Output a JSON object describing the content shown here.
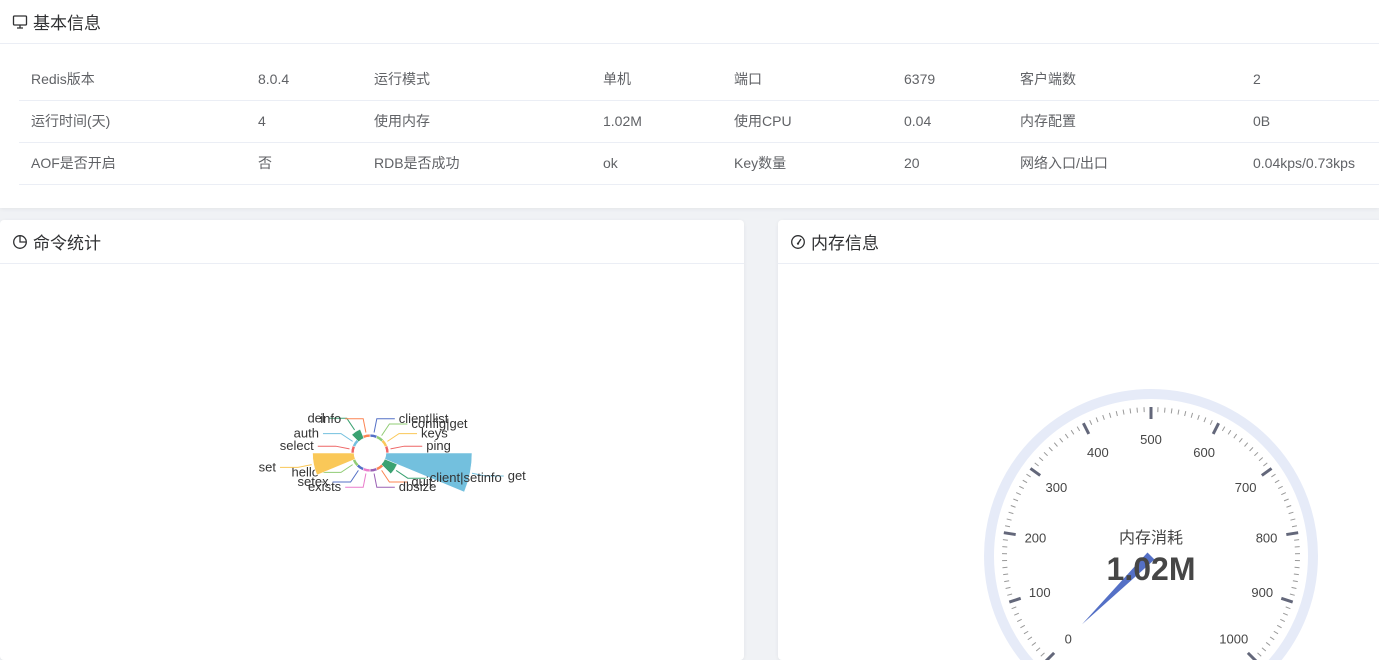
{
  "basic_info": {
    "title": "基本信息",
    "rows": [
      [
        "Redis版本",
        "8.0.4",
        "运行模式",
        "单机",
        "端口",
        "6379",
        "客户端数",
        "2"
      ],
      [
        "运行时间(天)",
        "4",
        "使用内存",
        "1.02M",
        "使用CPU",
        "0.04",
        "内存配置",
        "0B"
      ],
      [
        "AOF是否开启",
        "否",
        "RDB是否成功",
        "ok",
        "Key数量",
        "20",
        "网络入口/出口",
        "0.04kps/0.73kps"
      ]
    ]
  },
  "command_stats": {
    "title": "命令统计",
    "chart_data": {
      "type": "pie",
      "rose": true,
      "slices": [
        {
          "name": "client|list",
          "value": 1,
          "color": "#5470c6"
        },
        {
          "name": "config|get",
          "value": 1,
          "color": "#91cc75"
        },
        {
          "name": "keys",
          "value": 1,
          "color": "#fac858"
        },
        {
          "name": "ping",
          "value": 1,
          "color": "#ee6666"
        },
        {
          "name": "get",
          "value": 100,
          "color": "#73c0de"
        },
        {
          "name": "client|setinfo",
          "value": 6,
          "color": "#3ba272"
        },
        {
          "name": "quit",
          "value": 1,
          "color": "#fc8452"
        },
        {
          "name": "dbsize",
          "value": 1,
          "color": "#9a60b4"
        },
        {
          "name": "exists",
          "value": 1,
          "color": "#ea7ccc"
        },
        {
          "name": "setex",
          "value": 1,
          "color": "#5470c6"
        },
        {
          "name": "hello",
          "value": 1,
          "color": "#91cc75"
        },
        {
          "name": "set",
          "value": 30,
          "color": "#fac858"
        },
        {
          "name": "select",
          "value": 1,
          "color": "#ee6666"
        },
        {
          "name": "auth",
          "value": 1,
          "color": "#73c0de"
        },
        {
          "name": "del",
          "value": 4,
          "color": "#3ba272"
        },
        {
          "name": "info",
          "value": 1,
          "color": "#fc8452"
        }
      ]
    }
  },
  "memory_info": {
    "title": "内存信息",
    "chart_data": {
      "type": "gauge",
      "min": 0,
      "max": 1000,
      "value": 1.02,
      "name": "内存消耗",
      "detail": "1.02M",
      "tick_labels": [
        "0",
        "100",
        "200",
        "300",
        "400",
        "500",
        "600",
        "700",
        "800",
        "900",
        "1000"
      ],
      "pointer_color": "#5470c6",
      "axis_color": "#e6ebf8"
    }
  }
}
